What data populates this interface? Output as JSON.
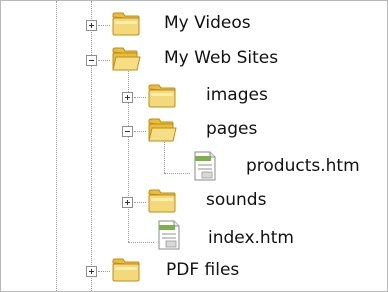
{
  "colors": {
    "folder_body": "#f4d97a",
    "folder_tab": "#e9bd3e",
    "folder_outline": "#c08e12",
    "guide_line": "#9c9c9c",
    "text": "#111111"
  },
  "tree": {
    "items": [
      {
        "label": "My Videos",
        "icon": "folder-icon",
        "expander": "collapsed"
      },
      {
        "label": "My Web Sites",
        "icon": "folder-open-icon",
        "expander": "expanded"
      },
      {
        "label": "images",
        "icon": "folder-icon",
        "expander": "collapsed"
      },
      {
        "label": "pages",
        "icon": "folder-open-icon",
        "expander": "expanded"
      },
      {
        "label": "products.htm",
        "icon": "html-file-icon",
        "expander": "none"
      },
      {
        "label": "sounds",
        "icon": "folder-icon",
        "expander": "collapsed"
      },
      {
        "label": "index.htm",
        "icon": "html-file-icon",
        "expander": "none"
      },
      {
        "label": "PDF files",
        "icon": "folder-icon",
        "expander": "collapsed"
      }
    ]
  }
}
